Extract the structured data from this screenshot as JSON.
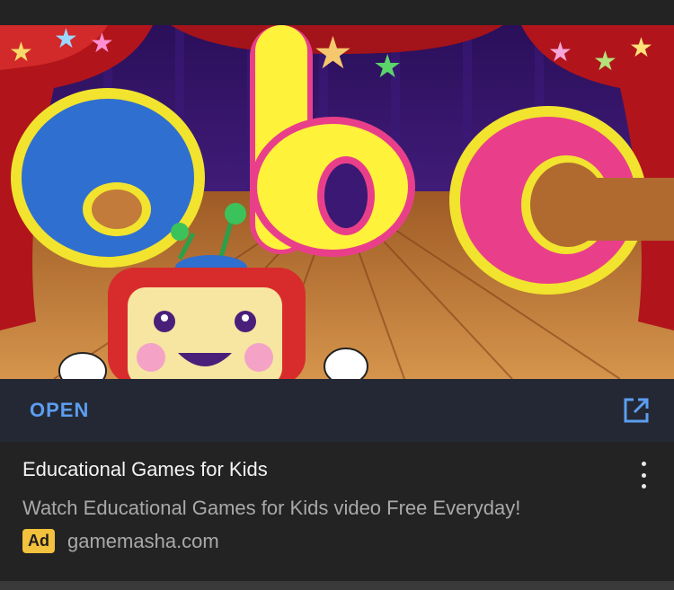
{
  "banner": {
    "letters": [
      "a",
      "b",
      "c"
    ],
    "colors": {
      "curtain": "#b1151b",
      "backdrop": "#3a1873",
      "stage": "#c27b3a",
      "a": "#2f6fcf",
      "b": "#fff23b",
      "c": "#e93f8a",
      "outline": "#f2e32e"
    }
  },
  "action_bar": {
    "open_label": "OPEN",
    "open_color": "#5b9ef0",
    "external_icon": "open-in-new-icon"
  },
  "ad": {
    "title": "Educational Games for Kids",
    "description": "Watch Educational Games for Kids video Free Everyday!",
    "badge": "Ad",
    "badge_color": "#f2c13d",
    "domain": "gamemasha.com",
    "menu_icon": "more-vert-icon"
  }
}
